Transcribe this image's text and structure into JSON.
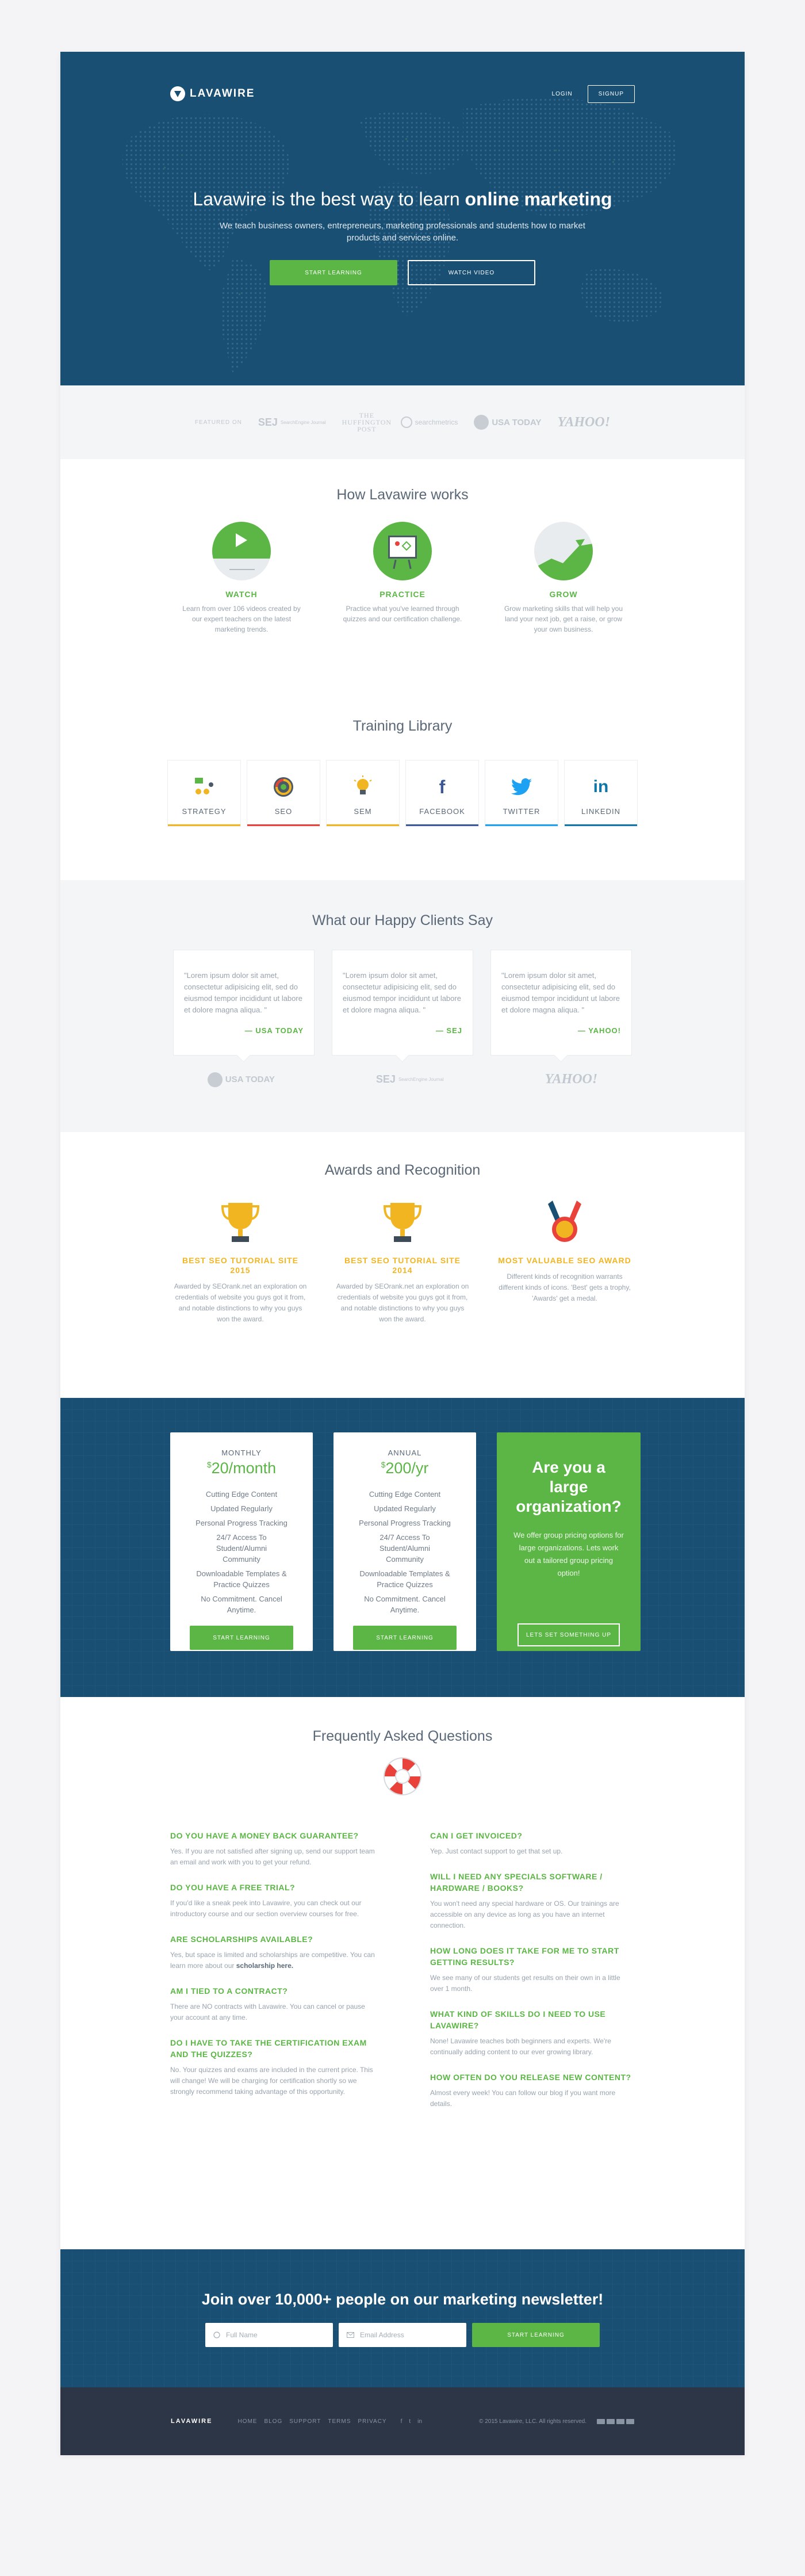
{
  "nav": {
    "logo": "LAVAWIRE",
    "login": "LOGIN",
    "signup": "SIGNUP"
  },
  "hero": {
    "title_pre": "Lavawire is the best way to learn ",
    "title_bold": "online marketing",
    "subtitle": "We teach business owners, entrepreneurs, marketing professionals and students how to market products and services online.",
    "cta_primary": "START LEARNING",
    "cta_secondary": "WATCH VIDEO"
  },
  "featured": {
    "label": "FEATURED ON",
    "logos": [
      "SEJ",
      "THE HUFFINGTON POST",
      "searchmetrics",
      "USA TODAY",
      "YAHOO!"
    ],
    "sej_small": "SearchEngine Journal"
  },
  "how": {
    "title": "How Lavawire works",
    "steps": [
      {
        "title": "WATCH",
        "text": "Learn from over 106 videos created by our expert teachers on the latest marketing trends."
      },
      {
        "title": "PRACTICE",
        "text": "Practice what you've learned through quizzes and our certification challenge."
      },
      {
        "title": "GROW",
        "text": "Grow marketing skills that will help you land your next job, get a raise, or grow your own business."
      }
    ]
  },
  "library": {
    "title": "Training Library",
    "items": [
      {
        "label": "STRATEGY",
        "color": "#f2b522"
      },
      {
        "label": "SEO",
        "color": "#e8423a"
      },
      {
        "label": "SEM",
        "color": "#f2b522"
      },
      {
        "label": "FACEBOOK",
        "color": "#3b5998"
      },
      {
        "label": "TWITTER",
        "color": "#1da1f2"
      },
      {
        "label": "LINKEDIN",
        "color": "#0e76a8"
      }
    ]
  },
  "testimonials": {
    "title": "What our Happy Clients Say",
    "quotes": [
      {
        "text": "\"Lorem ipsum dolor sit amet, consectetur adipisicing elit, sed do eiusmod tempor incididunt ut labore et dolore magna aliqua. \"",
        "source": "— USA TODAY"
      },
      {
        "text": "\"Lorem ipsum dolor sit amet, consectetur adipisicing elit, sed do eiusmod tempor incididunt ut labore et dolore magna aliqua. \"",
        "source": "— SEJ"
      },
      {
        "text": "\"Lorem ipsum dolor sit amet, consectetur adipisicing elit, sed do eiusmod tempor incididunt ut labore et dolore magna aliqua. \"",
        "source": "— YAHOO!"
      }
    ],
    "logos": [
      "USA TODAY",
      "SEJ",
      "YAHOO!"
    ]
  },
  "awards": {
    "title": "Awards and Recognition",
    "items": [
      {
        "title": "BEST SEO TUTORIAL SITE 2015",
        "text": "Awarded by SEOrank.net an exploration on credentials of website you guys got it from, and notable distinctions to why you guys won the award."
      },
      {
        "title": "BEST SEO TUTORIAL SITE 2014",
        "text": "Awarded by SEOrank.net an exploration on credentials of website you guys got it from, and notable distinctions to why you guys won the award."
      },
      {
        "title": "MOST VALUABLE SEO AWARD",
        "text": "Different kinds of recognition warrants different kinds of icons. 'Best' gets a trophy, 'Awards' get a medal."
      }
    ]
  },
  "pricing": {
    "plans": [
      {
        "period": "MONTHLY",
        "currency": "$",
        "price": "20/month",
        "features": [
          "Cutting Edge Content",
          "Updated Regularly",
          "Personal Progress Tracking",
          "24/7 Access To Student/Alumni Community",
          "Downloadable Templates & Practice Quizzes",
          "No Commitment. Cancel Anytime."
        ],
        "cta": "START LEARNING"
      },
      {
        "period": "ANNUAL",
        "currency": "$",
        "price": "200/yr",
        "features": [
          "Cutting Edge Content",
          "Updated Regularly",
          "Personal Progress Tracking",
          "24/7 Access To Student/Alumni Community",
          "Downloadable Templates & Practice Quizzes",
          "No Commitment. Cancel Anytime."
        ],
        "cta": "START LEARNING"
      }
    ],
    "org": {
      "title": "Are you a large organization?",
      "text": "We offer group pricing options for large organizations. Lets work out a tailored group pricing option!",
      "cta": "LETS SET SOMETHING UP"
    }
  },
  "faq": {
    "title": "Frequently Asked Questions",
    "left": [
      {
        "q": "DO YOU HAVE A MONEY BACK GUARANTEE?",
        "a": "Yes. If you are not satisfied after signing up, send our support team an email and work with you to get your refund."
      },
      {
        "q": "DO YOU HAVE A FREE TRIAL?",
        "a": "If you'd like a sneak peek into Lavawire, you can check out our introductory course and our section overview courses for free."
      },
      {
        "q": "ARE SCHOLARSHIPS AVAILABLE?",
        "a": "Yes, but space is limited and  scholarships are competitive. You can learn more about our ",
        "a_bold": "scholarship here."
      },
      {
        "q": "AM I TIED TO A CONTRACT?",
        "a": "There are NO contracts with Lavawire. You can cancel or pause your account at any time."
      },
      {
        "q": "DO I HAVE TO TAKE THE CERTIFICATION EXAM AND THE QUIZZES?",
        "a": "No. Your quizzes and exams are included in the current price. This will change! We will be charging for certification shortly so we strongly recommend taking advantage of this opportunity."
      }
    ],
    "right": [
      {
        "q": "CAN I GET INVOICED?",
        "a": "Yep. Just contact support to get that set up."
      },
      {
        "q": "WILL I NEED ANY SPECIALS SOFTWARE / HARDWARE / BOOKS?",
        "a": "You won't need any special hardware or OS. Our trainings are accessible on any device as long as you have an internet connection."
      },
      {
        "q": "HOW LONG DOES IT TAKE FOR ME TO START GETTING RESULTS?",
        "a": "We see many of our students get results on their own in a little over 1 month."
      },
      {
        "q": "WHAT KIND OF SKILLS DO I NEED TO USE LAVAWIRE?",
        "a": "None! Lavawire teaches both beginners and experts. We're continually adding content to our ever growing library."
      },
      {
        "q": "HOW OFTEN DO YOU RELEASE NEW CONTENT?",
        "a": "Almost every week! You can follow our blog if you want more details."
      }
    ]
  },
  "newsletter": {
    "title_pre": "Join over ",
    "title_bold": "10,000+ people",
    "title_post": " on our marketing newsletter!",
    "name_placeholder": "Full Name",
    "email_placeholder": "Email Address",
    "cta": "START LEARNING"
  },
  "footer": {
    "logo": "LAVAWIRE",
    "links": [
      "HOME",
      "BLOG",
      "SUPPORT",
      "TERMS",
      "PRIVACY"
    ],
    "social": [
      "f",
      "t",
      "in"
    ],
    "copyright": "© 2015 Lavawire, LLC. All rights reserved."
  }
}
